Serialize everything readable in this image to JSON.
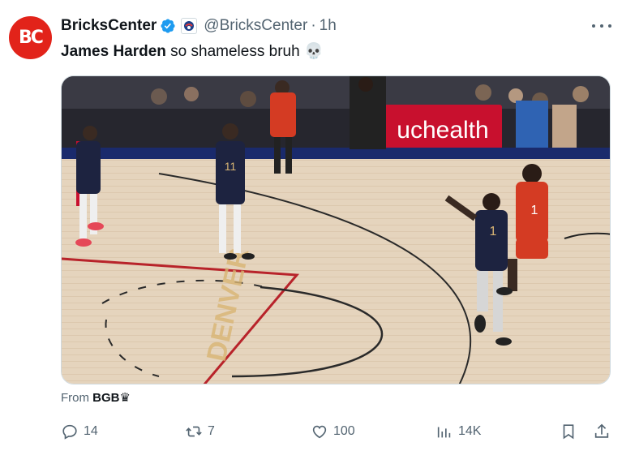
{
  "author": {
    "avatar_text": "BC",
    "display_name": "BricksCenter",
    "handle": "@BricksCenter",
    "separator": "·",
    "time": "1h",
    "verified_color": "#1d9bf0",
    "avatar_color": "#e2231a"
  },
  "tweet": {
    "bold_text": "James Harden",
    "text": " so shameless bruh ",
    "emoji": "💀"
  },
  "media": {
    "type": "video-still",
    "sign_text": "uchealth",
    "jersey_number_red": "1",
    "jersey_number_blue": "1",
    "jersey_number_back": "11",
    "court_text": "DENVER"
  },
  "attribution": {
    "prefix": "From",
    "source": "BGB♛"
  },
  "actions": {
    "replies": "14",
    "reposts": "7",
    "likes": "100",
    "views": "14K"
  },
  "icons": [
    "verified-icon",
    "affiliate-badge-icon",
    "more-icon",
    "reply-icon",
    "repost-icon",
    "like-icon",
    "views-icon",
    "bookmark-icon",
    "share-icon"
  ]
}
